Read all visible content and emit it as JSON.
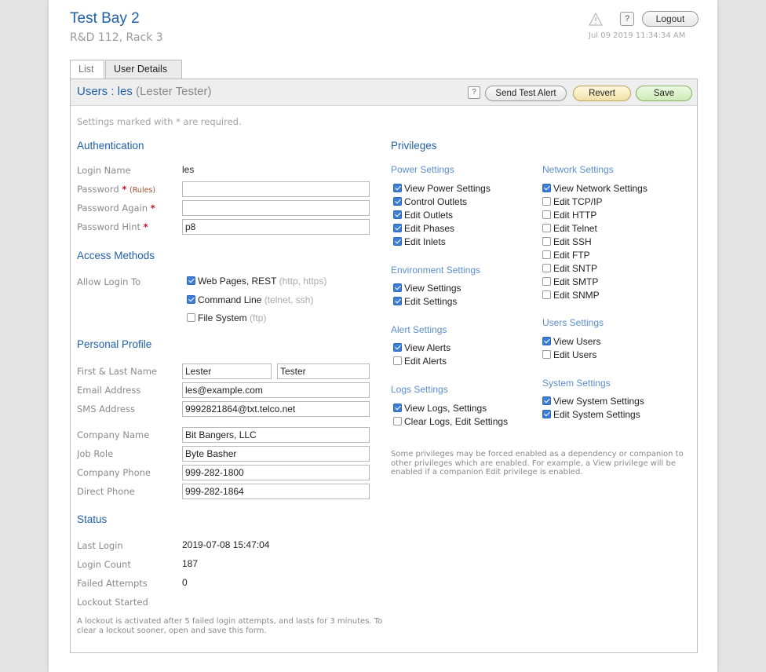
{
  "header": {
    "title": "Test Bay 2",
    "subtitle": "R&D 112, Rack 3",
    "help_label": "?",
    "logout_label": "Logout",
    "timestamp": "Jul 09 2019 11:34:34 AM"
  },
  "tabs": [
    {
      "label": "List"
    },
    {
      "label": "User Details"
    }
  ],
  "panel": {
    "title_prefix": "Users : les",
    "title_name": "(Lester Tester)",
    "help_label": "?",
    "send_test_alert_label": "Send Test Alert",
    "revert_label": "Revert",
    "save_label": "Save",
    "required_note": "Settings marked with * are required."
  },
  "auth": {
    "heading": "Authentication",
    "login_name_label": "Login Name",
    "login_name_value": "les",
    "password_label": "Password",
    "password_rules": "(Rules)",
    "password_value": "",
    "password_again_label": "Password Again",
    "password_again_value": "",
    "password_hint_label": "Password Hint",
    "password_hint_value": "p8",
    "star": "*"
  },
  "access": {
    "heading": "Access Methods",
    "allow_label": "Allow Login To",
    "options": [
      {
        "label": "Web Pages, REST",
        "hint": "(http, https)",
        "checked": true
      },
      {
        "label": "Command Line",
        "hint": "(telnet, ssh)",
        "checked": true
      },
      {
        "label": "File System",
        "hint": "(ftp)",
        "checked": false
      }
    ]
  },
  "profile": {
    "heading": "Personal Profile",
    "name_label": "First & Last Name",
    "first_name": "Lester",
    "last_name": "Tester",
    "email_label": "Email Address",
    "email_value": "les@example.com",
    "sms_label": "SMS Address",
    "sms_value": "9992821864@txt.telco.net",
    "company_label": "Company Name",
    "company_value": "Bit Bangers, LLC",
    "role_label": "Job Role",
    "role_value": "Byte Basher",
    "company_phone_label": "Company Phone",
    "company_phone_value": "999-282-1800",
    "direct_phone_label": "Direct Phone",
    "direct_phone_value": "999-282-1864"
  },
  "status": {
    "heading": "Status",
    "last_login_label": "Last Login",
    "last_login_value": "2019-07-08 15:47:04",
    "login_count_label": "Login Count",
    "login_count_value": "187",
    "failed_label": "Failed Attempts",
    "failed_value": "0",
    "lockout_label": "Lockout Started",
    "lockout_note": "A lockout is activated after 5 failed login attempts, and lasts for 3 minutes. To clear a lockout sooner, open and save this form."
  },
  "privileges": {
    "heading": "Privileges",
    "power": {
      "heading": "Power Settings",
      "items": [
        {
          "label": "View Power Settings",
          "checked": true
        },
        {
          "label": "Control Outlets",
          "checked": true
        },
        {
          "label": "Edit Outlets",
          "checked": true
        },
        {
          "label": "Edit Phases",
          "checked": true
        },
        {
          "label": "Edit Inlets",
          "checked": true
        }
      ]
    },
    "environment": {
      "heading": "Environment Settings",
      "items": [
        {
          "label": "View Settings",
          "checked": true
        },
        {
          "label": "Edit Settings",
          "checked": true
        }
      ]
    },
    "alert": {
      "heading": "Alert Settings",
      "items": [
        {
          "label": "View Alerts",
          "checked": true
        },
        {
          "label": "Edit Alerts",
          "checked": false
        }
      ]
    },
    "logs": {
      "heading": "Logs Settings",
      "items": [
        {
          "label": "View Logs, Settings",
          "checked": true
        },
        {
          "label": "Clear Logs, Edit Settings",
          "checked": false
        }
      ]
    },
    "network": {
      "heading": "Network Settings",
      "items": [
        {
          "label": "View Network Settings",
          "checked": true
        },
        {
          "label": "Edit TCP/IP",
          "checked": false
        },
        {
          "label": "Edit HTTP",
          "checked": false
        },
        {
          "label": "Edit Telnet",
          "checked": false
        },
        {
          "label": "Edit SSH",
          "checked": false
        },
        {
          "label": "Edit FTP",
          "checked": false
        },
        {
          "label": "Edit SNTP",
          "checked": false
        },
        {
          "label": "Edit SMTP",
          "checked": false
        },
        {
          "label": "Edit SNMP",
          "checked": false
        }
      ]
    },
    "users": {
      "heading": "Users Settings",
      "items": [
        {
          "label": "View Users",
          "checked": true
        },
        {
          "label": "Edit Users",
          "checked": false
        }
      ]
    },
    "system": {
      "heading": "System Settings",
      "items": [
        {
          "label": "View System Settings",
          "checked": true
        },
        {
          "label": "Edit System Settings",
          "checked": true
        }
      ]
    },
    "note": "Some privileges may be forced enabled as a dependency or companion to other privileges which are enabled. For example, a View privilege will be enabled if a companion Edit privilege is enabled."
  },
  "colors": {
    "accent": "#1f5fa8",
    "subheading": "#5b8fcf",
    "required": "#c8102e",
    "checkbox": "#3d7fd6"
  }
}
